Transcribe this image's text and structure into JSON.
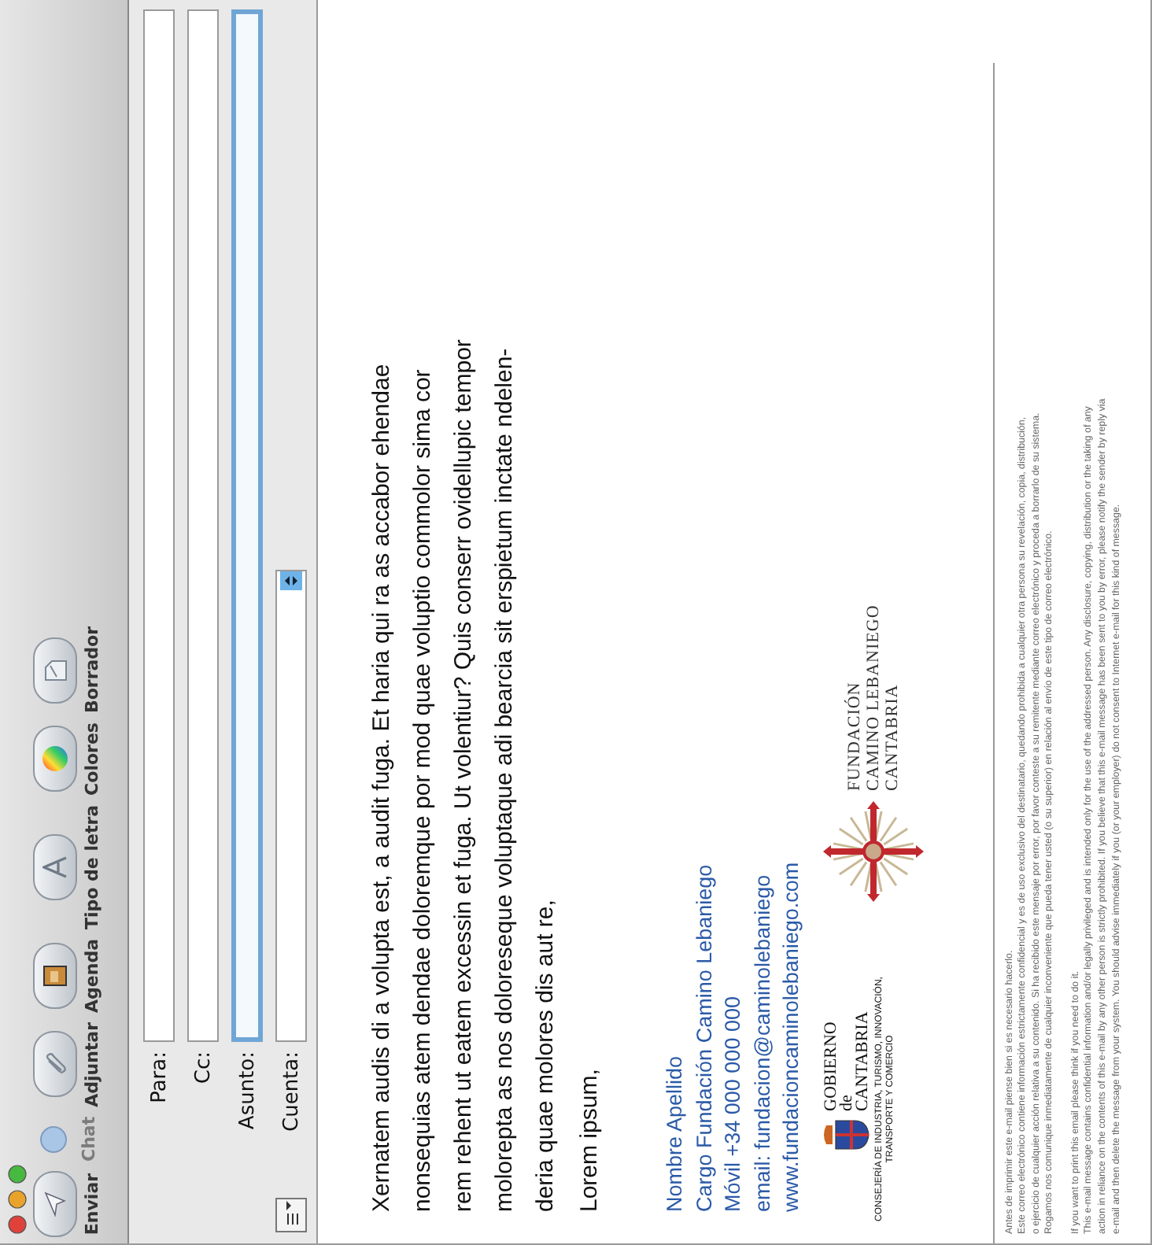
{
  "toolbar": [
    {
      "label": "Enviar",
      "kind": "send",
      "disabled": false
    },
    {
      "label": "Chat",
      "kind": "chat",
      "disabled": true
    },
    {
      "label": "Adjuntar",
      "kind": "attach",
      "disabled": false
    },
    {
      "label": "Agenda",
      "kind": "contacts",
      "disabled": false
    },
    {
      "label": "Tipo de letra",
      "kind": "fonts",
      "disabled": false
    },
    {
      "label": "Colores",
      "kind": "colors",
      "disabled": false
    },
    {
      "label": "Borrador",
      "kind": "draft",
      "disabled": false
    }
  ],
  "headers": [
    {
      "label": "Para:",
      "kind": "text",
      "focused": false
    },
    {
      "label": "Cc:",
      "kind": "text",
      "focused": false
    },
    {
      "label": "Asunto:",
      "kind": "text",
      "focused": true
    },
    {
      "label": "Cuenta:",
      "kind": "popup",
      "focused": false
    }
  ],
  "body": {
    "paragraphs": [
      [
        "Xernatem audis di a volupta est,  a audit fuga. Et haria qui ra as accabor ehendae",
        "nonsequias atem dendae doloremque por mod quae voluptio commolor sima cor",
        "rem rehent ut eatem excessin et fuga. Ut volentiur? Quis conserr ovidellupic tempor",
        "molorepta as nos doloreseque voluptaque adi bearcia sit erspietum inctate ndelen-",
        "deria quae molores dis aut re,"
      ],
      [
        "Lorem ipsum,"
      ]
    ]
  },
  "signature": [
    "Nombre Apellido",
    "Cargo Fundación Camino Lebaniego",
    "Móvil +34 000 000 000",
    "email: fundacion@caminolebaniego",
    "www.fundacioncaminolebaniego.com"
  ],
  "logos": {
    "gobierno": {
      "lines": [
        "GOBIERNO",
        "de",
        "CANTABRIA"
      ],
      "department": [
        "CONSEJERÍA DE INDUSTRIA, TURISMO, INNOVACIÓN,",
        "TRANSPORTE Y COMERCIO"
      ]
    },
    "fundacion": {
      "lines": [
        "FUNDACIÓN",
        "CAMINO LEBANIEGO",
        "CANTABRIA"
      ]
    }
  },
  "disclaimer": [
    [
      "Antes de imprimir este e-mail piense bien si es necesario hacerlo.",
      "Este correo electrónico contiene información estrictamente confidencial y es de uso exclusivo del destinatario, quedando prohibida a cualquier otra persona su revelación, copia, distribución,",
      "o ejercicio de cualquier acción relativa a su contenido. Si ha recibido este mensaje por error, por favor conteste a su remitente mediante correo electrónico y proceda a borrarlo de su sistema.",
      "Rogamos nos comunique inmediatamente de cualquier inconveniente que pueda tener usted (o su superior) en relación al envío de este tipo de correo electrónico."
    ],
    [
      "If you want to print this email please think if you need to do it.",
      "This e-mail message contains confidential information and/or legally privileged and is intended only for the use of the addressed person. Any disclosure, copying, distribution or the taking of any",
      "action in reliance on the contents of this e-mail by any other person is strictly prohibited. If you believe that this e-mail message has been sent to you by error, please notify the sender by reply via",
      "e-mail and then delete the message from your system. You should advise immediately if you (or your employer) do not consent to Internet e-mail for this kind of message."
    ]
  ]
}
